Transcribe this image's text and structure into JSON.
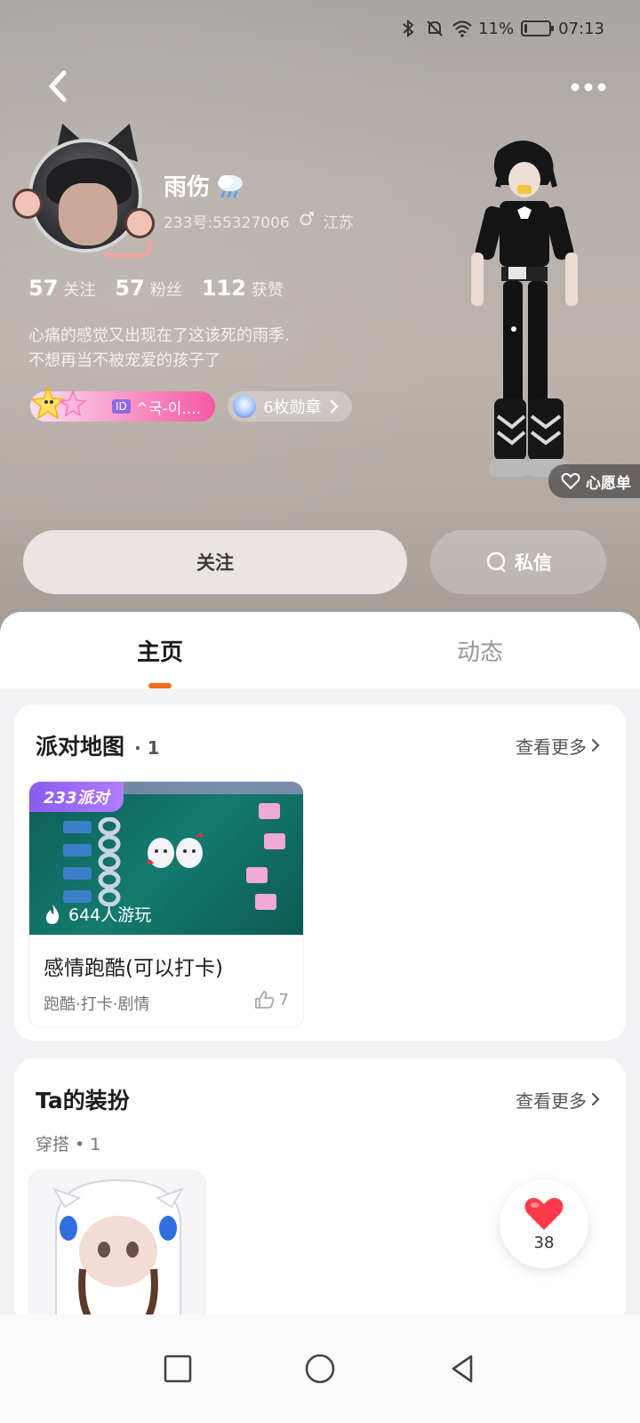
{
  "status_bar": {
    "battery": "11%",
    "time": "07:13",
    "battery_level": 0.11
  },
  "profile": {
    "name": "雨伤",
    "meta_id": "233号:55327006",
    "location": "江苏",
    "stats": [
      {
        "num": "57",
        "label": "关注"
      },
      {
        "num": "57",
        "label": "粉丝"
      },
      {
        "num": "112",
        "label": "获赞"
      }
    ],
    "bio_lines": [
      "心痛的感觉又出现在了这该死的雨季.",
      "不想再当不被宠爱的孩子了"
    ],
    "id_tag": "ID",
    "id_text": "^국-이....",
    "medals": "6枚勋章",
    "wishlist": "心愿单"
  },
  "actions": {
    "follow": "关注",
    "message": "私信"
  },
  "tabs": [
    {
      "label": "主页",
      "active": true
    },
    {
      "label": "动态",
      "active": false
    }
  ],
  "party_map": {
    "title": "派对地图",
    "count": "· 1",
    "see_more": "查看更多",
    "game": {
      "badge": "233派对",
      "plays": "644人游玩",
      "title": "感情跑酷(可以打卡)",
      "tags": "跑酷·打卡·剧情",
      "likes": "7"
    }
  },
  "outfits": {
    "title": "Ta的装扮",
    "see_more": "查看更多",
    "subtitle": "穿搭 • 1"
  },
  "like_fab": {
    "count": "38"
  },
  "colors": {
    "accent": "#f26a1b",
    "party_purple": "#8a5cf0",
    "heart": "#ff3b4b"
  }
}
